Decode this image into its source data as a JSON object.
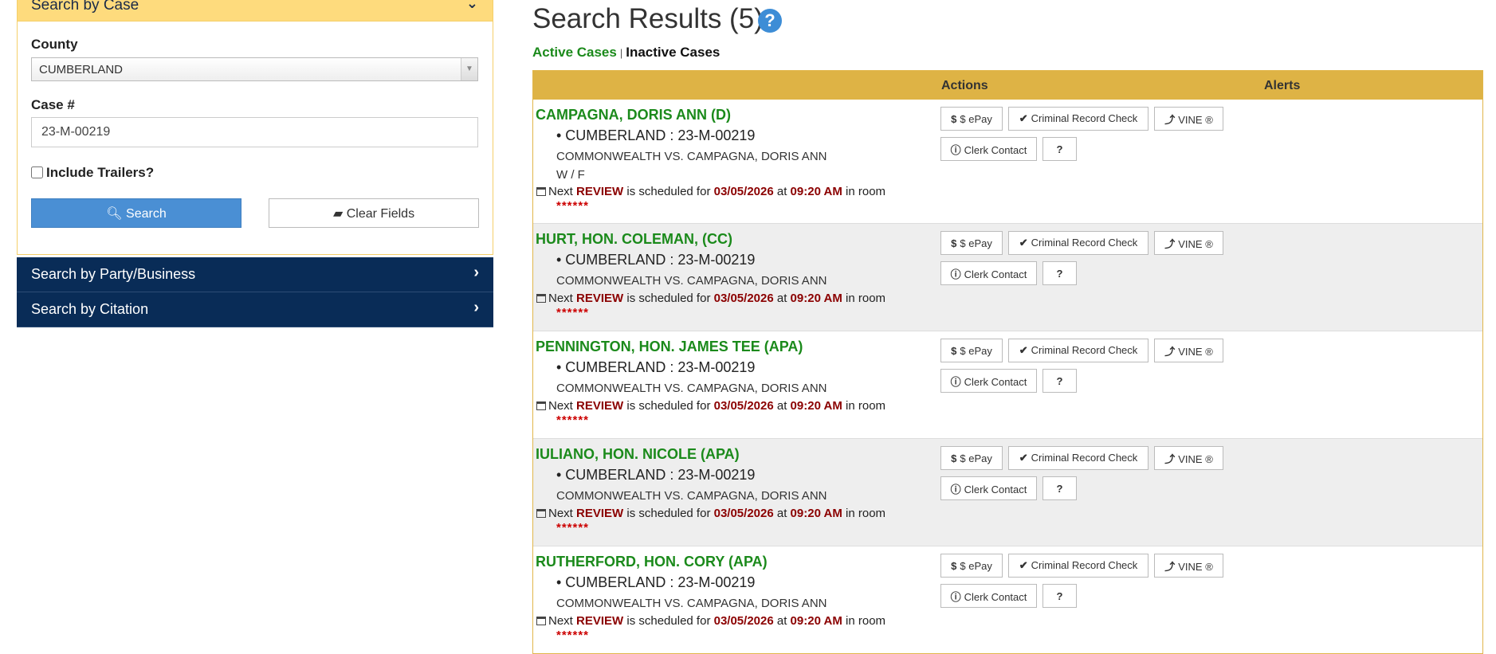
{
  "left": {
    "search_by_case": {
      "title": "Search by Case",
      "county_label": "County",
      "county_value": "CUMBERLAND",
      "case_label": "Case #",
      "case_value": "23-M-00219",
      "trailers_label": "Include Trailers?",
      "search_label": "Search",
      "clear_label": "Clear Fields"
    },
    "party_title": "Search by Party/Business",
    "citation_title": "Search by Citation"
  },
  "results": {
    "title": "Search Results (5)",
    "active_label": "Active Cases",
    "separator": "|",
    "inactive_label": "Inactive Cases",
    "col_actions": "Actions",
    "col_alerts": "Alerts",
    "buttons": {
      "epay": "$ ePay",
      "record": "Criminal Record Check",
      "vine": "VINE ®",
      "clerk": "Clerk Contact"
    },
    "rows": [
      {
        "name": "CAMPAGNA, DORIS ANN (D)",
        "county_case": "• CUMBERLAND : 23-M-00219",
        "style": "COMMONWEALTH VS. CAMPAGNA, DORIS ANN",
        "extra": "W / F",
        "next_prefix": "Next",
        "event": "REVIEW",
        "sched": "is scheduled for",
        "date": "03/05/2026",
        "at": "at",
        "time": "09:20 AM",
        "room": "in room",
        "stars": "******"
      },
      {
        "name": "HURT, HON. COLEMAN, (CC)",
        "county_case": "• CUMBERLAND : 23-M-00219",
        "style": "COMMONWEALTH VS. CAMPAGNA, DORIS ANN",
        "next_prefix": "Next",
        "event": "REVIEW",
        "sched": "is scheduled for",
        "date": "03/05/2026",
        "at": "at",
        "time": "09:20 AM",
        "room": "in room",
        "stars": "******"
      },
      {
        "name": "PENNINGTON, HON. JAMES TEE (APA)",
        "county_case": "• CUMBERLAND : 23-M-00219",
        "style": "COMMONWEALTH VS. CAMPAGNA, DORIS ANN",
        "next_prefix": "Next",
        "event": "REVIEW",
        "sched": "is scheduled for",
        "date": "03/05/2026",
        "at": "at",
        "time": "09:20 AM",
        "room": "in room",
        "stars": "******"
      },
      {
        "name": "IULIANO, HON. NICOLE (APA)",
        "county_case": "• CUMBERLAND : 23-M-00219",
        "style": "COMMONWEALTH VS. CAMPAGNA, DORIS ANN",
        "next_prefix": "Next",
        "event": "REVIEW",
        "sched": "is scheduled for",
        "date": "03/05/2026",
        "at": "at",
        "time": "09:20 AM",
        "room": "in room",
        "stars": "******"
      },
      {
        "name": "RUTHERFORD, HON. CORY (APA)",
        "county_case": "• CUMBERLAND : 23-M-00219",
        "style": "COMMONWEALTH VS. CAMPAGNA, DORIS ANN",
        "next_prefix": "Next",
        "event": "REVIEW",
        "sched": "is scheduled for",
        "date": "03/05/2026",
        "at": "at",
        "time": "09:20 AM",
        "room": "in room",
        "stars": "******"
      }
    ]
  }
}
